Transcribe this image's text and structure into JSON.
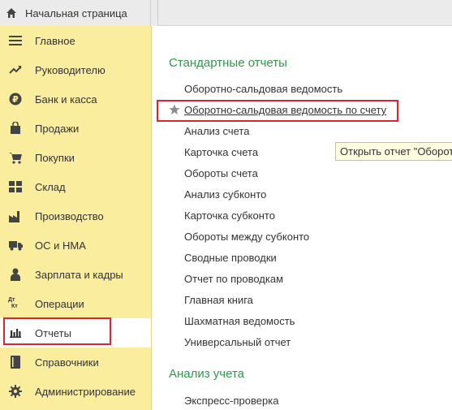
{
  "top": {
    "home_label": "Начальная страница"
  },
  "sidebar": {
    "items": [
      {
        "label": "Главное",
        "icon": "menu-lines-icon"
      },
      {
        "label": "Руководителю",
        "icon": "trend-icon"
      },
      {
        "label": "Банк и касса",
        "icon": "ruble-coin-icon"
      },
      {
        "label": "Продажи",
        "icon": "shopping-bag-icon"
      },
      {
        "label": "Покупки",
        "icon": "cart-icon"
      },
      {
        "label": "Склад",
        "icon": "warehouse-grid-icon"
      },
      {
        "label": "Производство",
        "icon": "factory-icon"
      },
      {
        "label": "ОС и НМА",
        "icon": "truck-icon"
      },
      {
        "label": "Зарплата и кадры",
        "icon": "person-icon"
      },
      {
        "label": "Операции",
        "icon": "dt-kt-icon"
      },
      {
        "label": "Отчеты",
        "icon": "bar-chart-icon"
      },
      {
        "label": "Справочники",
        "icon": "book-icon"
      },
      {
        "label": "Администрирование",
        "icon": "gear-icon"
      }
    ],
    "active_item": "Отчеты",
    "dt_label": "Дт",
    "kt_label": "Кт"
  },
  "content": {
    "section1_title": "Стандартные отчеты",
    "standard_reports": [
      "Оборотно-сальдовая ведомость",
      "Оборотно-сальдовая ведомость по счету",
      "Анализ счета",
      "Карточка счета",
      "Обороты счета",
      "Анализ субконто",
      "Карточка субконто",
      "Обороты между субконто",
      "Сводные проводки",
      "Отчет по проводкам",
      "Главная книга",
      "Шахматная ведомость",
      "Универсальный отчет"
    ],
    "selected_report": "Оборотно-сальдовая ведомость по счету",
    "section2_title": "Анализ учета",
    "analysis_reports": [
      "Экспресс-проверка"
    ],
    "tooltip": "Открыть отчет \"Оборот"
  },
  "colors": {
    "sidebar_bg": "#fbed9e",
    "section_title": "#2e9a48",
    "highlight_border": "#d9262f",
    "tooltip_bg": "#fffde0"
  }
}
